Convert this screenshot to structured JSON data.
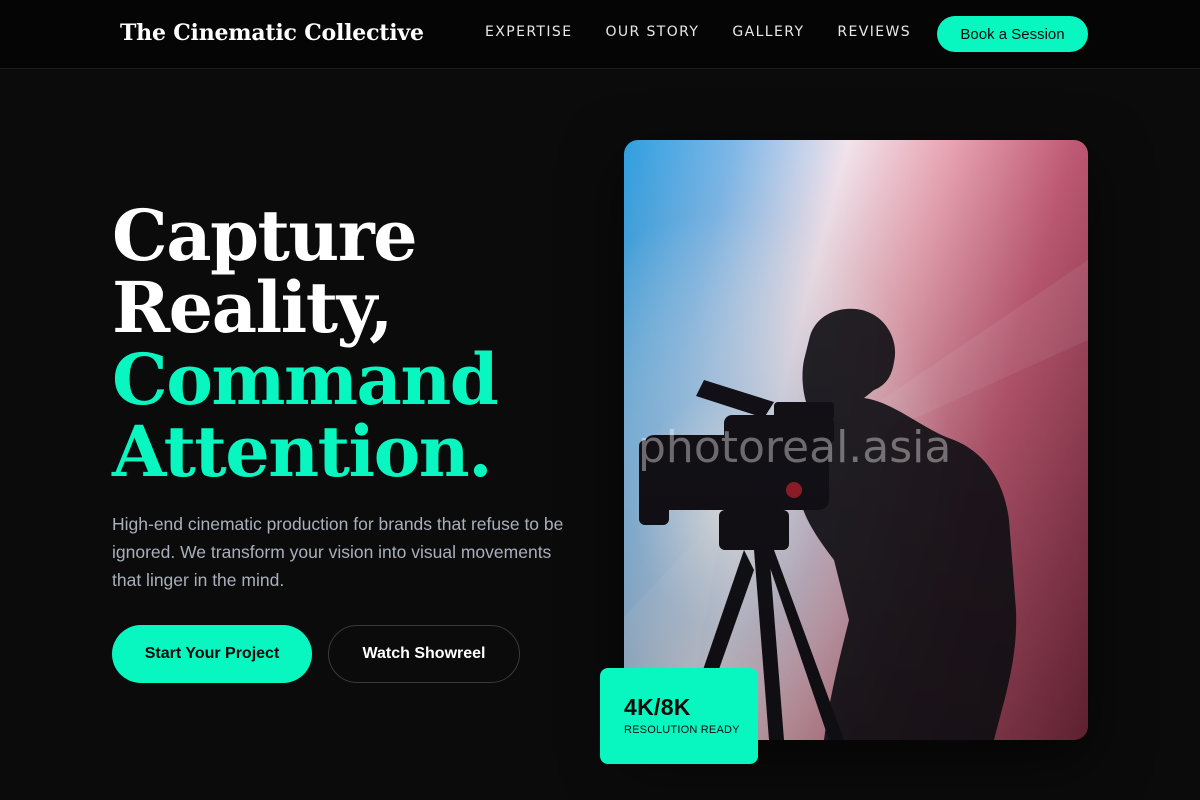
{
  "header": {
    "brand": "The Cinematic Collective",
    "nav": [
      "EXPERTISE",
      "OUR STORY",
      "GALLERY",
      "REVIEWS"
    ],
    "cta_label": "Book a Session"
  },
  "hero": {
    "headline_lines": [
      "Capture",
      "Reality,",
      "Command",
      "Attention."
    ],
    "subcopy": "High-end cinematic production for brands that refuse to be ignored. We transform your vision into visual movements that linger in the mind.",
    "primary_button": "Start Your Project",
    "secondary_button": "Watch Showreel",
    "image_watermark": "photoreal.asia",
    "badge": {
      "value": "4K/8K",
      "label": "RESOLUTION READY"
    }
  },
  "colors": {
    "background": "#0b0b0b",
    "accent": "#08f7c1",
    "text_muted": "#a9b0bb"
  }
}
